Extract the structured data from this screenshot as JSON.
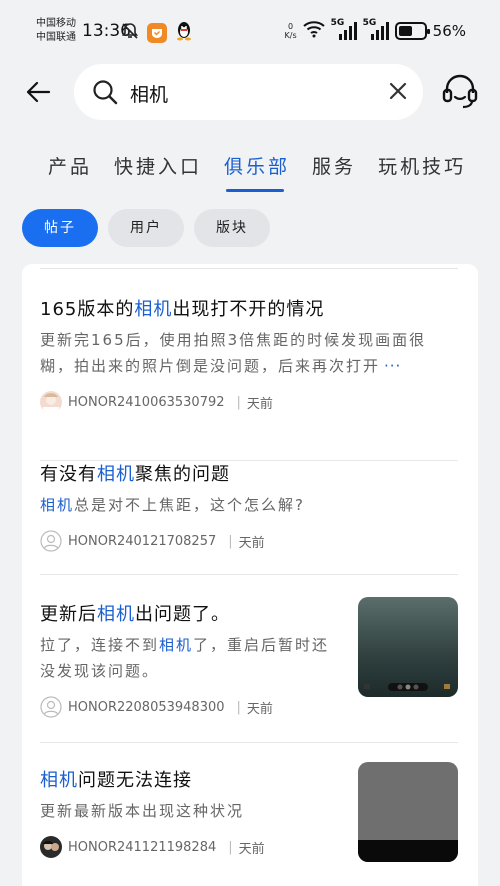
{
  "status_bar": {
    "carrier_1": "中国移动",
    "carrier_2": "中国联通",
    "time": "13:36",
    "speed_value": "0",
    "speed_unit": "K/s",
    "network_1": "5G",
    "network_2": "5G",
    "battery": "56%",
    "battery_level": 0.56
  },
  "search": {
    "query": "相机"
  },
  "tabs": [
    {
      "label": "产品"
    },
    {
      "label": "快捷入口"
    },
    {
      "label": "俱乐部"
    },
    {
      "label": "服务"
    },
    {
      "label": "玩机技巧"
    }
  ],
  "chips": [
    {
      "label": "帖子"
    },
    {
      "label": "用户"
    },
    {
      "label": "版块"
    }
  ],
  "posts": [
    {
      "title_pre": "165版本的",
      "title_hl": "相机",
      "title_post": "出现打不开的情况",
      "excerpt_pre": "",
      "excerpt_hl": "",
      "excerpt_post": "更新完165后，使用拍照3倍焦距的时候发现画面很糊，拍出来的照片倒是没问题，后来再次打开",
      "more": "···",
      "author": "HONOR2410063530792",
      "time": "天前"
    },
    {
      "title_pre": "有没有",
      "title_hl": "相机",
      "title_post": "聚焦的问题",
      "excerpt_pre": "",
      "excerpt_hl": "相机",
      "excerpt_post": "总是对不上焦距，这个怎么解?",
      "author": "HONOR240121708257",
      "time": "天前"
    },
    {
      "title_pre": "更新后",
      "title_hl": "相机",
      "title_post": "出问题了。",
      "excerpt_pre": "拉了，连接不到",
      "excerpt_hl": "相机",
      "excerpt_post": "了，重启后暂时还没发现该问题。",
      "author": "HONOR2208053948300",
      "time": "天前"
    },
    {
      "title_pre": "",
      "title_hl": "相机",
      "title_post": "问题无法连接",
      "excerpt_pre": "",
      "excerpt_hl": "",
      "excerpt_post": "更新最新版本出现这种状况",
      "author": "HONOR241121198284",
      "time": "天前"
    }
  ],
  "colors": {
    "accent": "#1a5fcf",
    "chip_active": "#1a6ff0",
    "background": "#f1f2f4"
  }
}
